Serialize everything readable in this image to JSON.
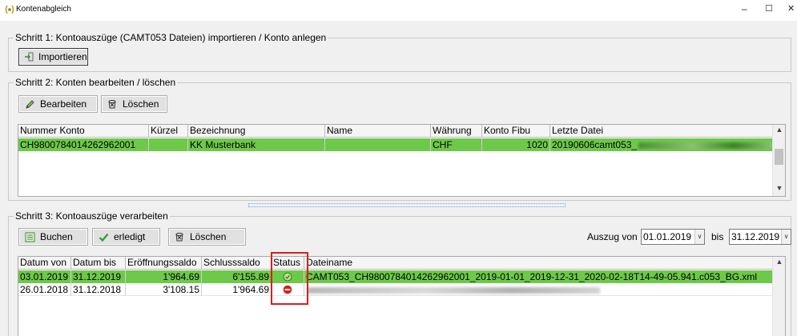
{
  "window": {
    "title": "Kontenabgleich",
    "minimize": "–",
    "maximize": "☐",
    "close": "✕"
  },
  "step1": {
    "title": "Schritt 1: Kontoauszüge (CAMT053 Dateien) importieren / Konto anlegen",
    "import_label": "Importieren"
  },
  "step2": {
    "title": "Schritt 2: Konten bearbeiten / löschen",
    "edit_label": "Bearbeiten",
    "delete_label": "Löschen",
    "columns": [
      "Nummer Konto",
      "Kürzel",
      "Bezeichnung",
      "Name",
      "Währung",
      "Konto Fibu",
      "Letzte Datei"
    ],
    "rows": [
      {
        "nummer": "CH9800784014262962001",
        "kuerzel": "",
        "bezeichnung": "KK Musterbank",
        "name": "",
        "waehrung": "CHF",
        "konto_fibu": "1020",
        "letzte_datei": "20190606camt053_"
      }
    ]
  },
  "step3": {
    "title": "Schritt 3: Kontoauszüge verarbeiten",
    "book_label": "Buchen",
    "done_label": "erledigt",
    "delete_label": "Löschen",
    "from_label": "Auszug von",
    "from_value": "01.01.2019",
    "to_label": "bis",
    "to_value": "31.12.2019",
    "columns": [
      "Datum von",
      "Datum bis",
      "Eröffnungssaldo",
      "Schlusssaldo",
      "Status",
      "Dateiname"
    ],
    "rows": [
      {
        "von": "03.01.2019",
        "bis": "31.12.2019",
        "eroeffnung": "1'964.69",
        "schluss": "6'155.89",
        "status": "ok",
        "datei": "CAMT053_CH9800784014262962001_2019-01-01_2019-12-31_2020-02-18T14-49-05.941.c053_BG.xml"
      },
      {
        "von": "26.01.2018",
        "bis": "31.12.2018",
        "eroeffnung": "3'108.15",
        "schluss": "1'964.69",
        "status": "error",
        "datei": ""
      }
    ]
  },
  "colors": {
    "selection": "#6ec94a",
    "highlight": "#e01b1b",
    "status_ok": "#7cc24e",
    "status_error": "#d81e1e"
  }
}
